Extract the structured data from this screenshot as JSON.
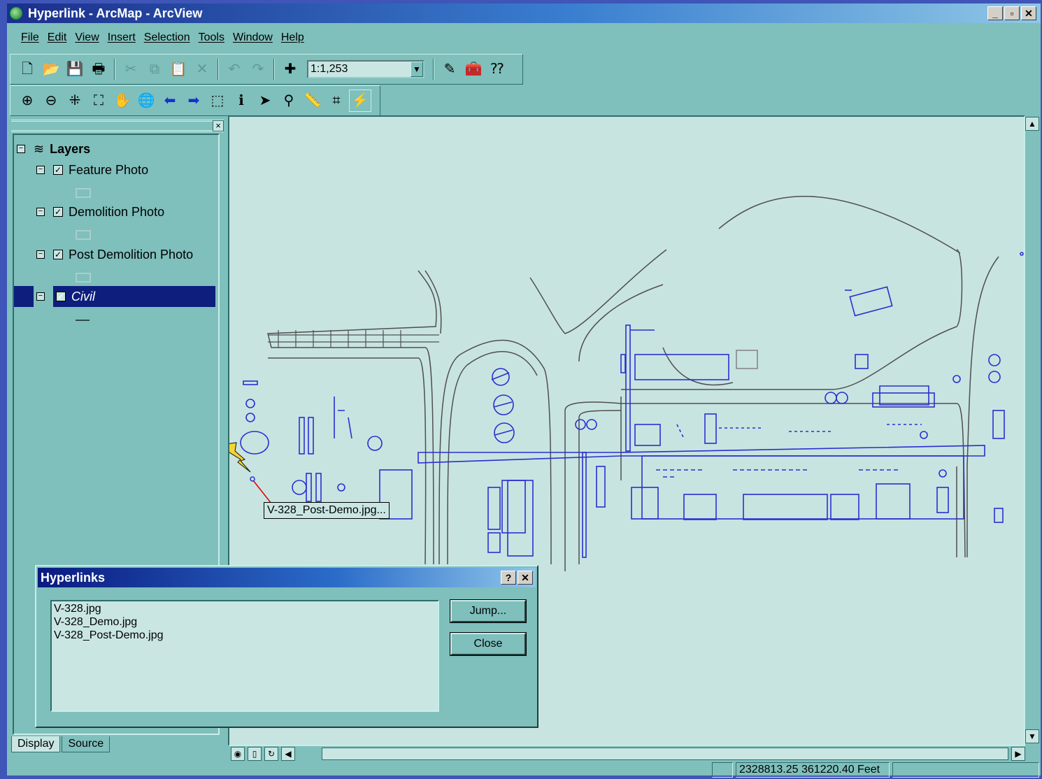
{
  "window": {
    "title": "Hyperlink - ArcMap - ArcView",
    "min": "_",
    "max": "▫",
    "close": "✕"
  },
  "menu": [
    "File",
    "Edit",
    "View",
    "Insert",
    "Selection",
    "Tools",
    "Window",
    "Help"
  ],
  "toolbar": {
    "scale": "1:1,253"
  },
  "toc": {
    "root": "Layers",
    "layers": [
      {
        "name": "Feature Photo",
        "checked": true
      },
      {
        "name": "Demolition Photo",
        "checked": true
      },
      {
        "name": "Post Demolition Photo",
        "checked": true
      },
      {
        "name": "Civil",
        "checked": true,
        "selected": true
      }
    ],
    "tabs": [
      "Display",
      "Source"
    ]
  },
  "map": {
    "tooltip": "V-328_Post-Demo.jpg..."
  },
  "dialog": {
    "title": "Hyperlinks",
    "help": "?",
    "close_x": "✕",
    "items": [
      "V-328.jpg",
      "V-328_Demo.jpg",
      "V-328_Post-Demo.jpg"
    ],
    "jump": "Jump...",
    "close": "Close"
  },
  "status": {
    "coords": "2328813.25  361220.40 Feet"
  },
  "colors": {
    "map_line": "#2a2fd0",
    "map_gray": "#4f4f4f",
    "accent": "#0d1e7c"
  }
}
